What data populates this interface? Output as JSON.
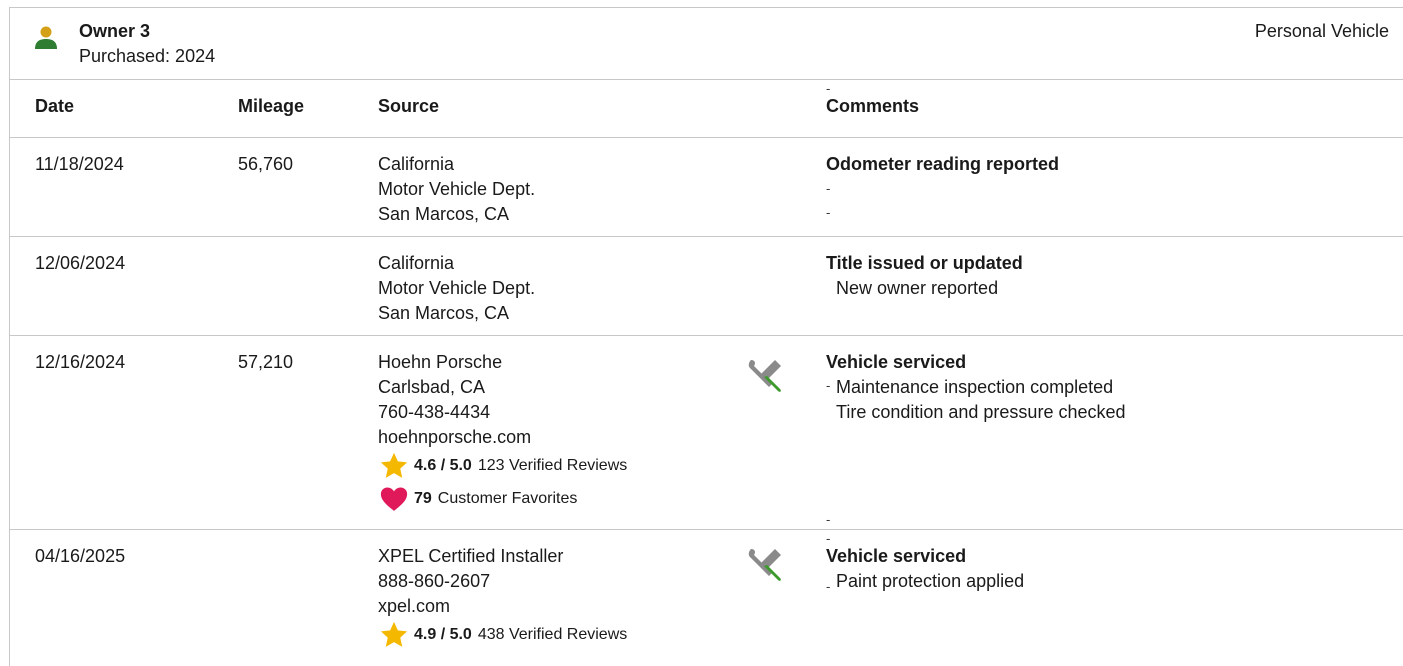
{
  "owner": {
    "name": "Owner 3",
    "purchased": "Purchased: 2024",
    "type": "Personal Vehicle",
    "icon": "person-icon",
    "icon_colors": {
      "head": "#d4a017",
      "body": "#2e7d32"
    }
  },
  "columns": {
    "date": "Date",
    "mileage": "Mileage",
    "source": "Source",
    "comments": "Comments"
  },
  "records": [
    {
      "date": "11/18/2024",
      "mileage": "56,760",
      "source": [
        "California",
        "Motor Vehicle Dept.",
        "San Marcos, CA"
      ],
      "comment_title": "Odometer reading reported",
      "comment_lines": []
    },
    {
      "date": "12/06/2024",
      "mileage": "",
      "source": [
        "California",
        "Motor Vehicle Dept.",
        "San Marcos, CA"
      ],
      "comment_title": "Title issued or updated",
      "comment_lines": [
        "New owner reported"
      ]
    },
    {
      "date": "12/16/2024",
      "mileage": "57,210",
      "source": [
        "Hoehn Porsche",
        "Carlsbad, CA",
        "760-438-4434",
        "hoehnporsche.com"
      ],
      "rating": {
        "score": "4.6 / 5.0",
        "reviews": "123 Verified Reviews"
      },
      "favorites": {
        "count": "79",
        "label": "Customer Favorites"
      },
      "service_icon": "wrench-screwdriver-icon",
      "comment_title": "Vehicle serviced",
      "comment_lines": [
        "Maintenance inspection completed",
        "Tire condition and pressure checked"
      ]
    },
    {
      "date": "04/16/2025",
      "mileage": "",
      "source": [
        "XPEL Certified Installer",
        "888-860-2607",
        "xpel.com"
      ],
      "rating": {
        "score": "4.9 / 5.0",
        "reviews": "438 Verified Reviews"
      },
      "service_icon": "wrench-screwdriver-icon",
      "comment_title": "Vehicle serviced",
      "comment_lines": [
        "Paint protection applied"
      ]
    }
  ],
  "colors": {
    "star": "#f5b800",
    "heart": "#e0195a",
    "wrench": "#8a8a8a",
    "screwdriver_handle": "#3a9a2a",
    "divider": "#c8c8c8"
  }
}
